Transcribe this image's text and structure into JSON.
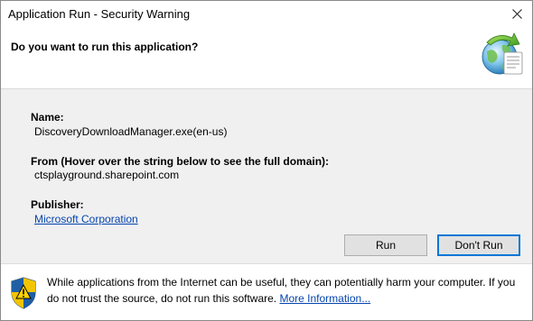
{
  "window": {
    "title": "Application Run - Security Warning",
    "close_glyph": "✕"
  },
  "header": {
    "question": "Do you want to run this application?",
    "icon": "application-globe-icon"
  },
  "details": {
    "name_label": "Name:",
    "name_value": "DiscoveryDownloadManager.exe(en-us)",
    "from_label": "From (Hover over the string below to see the full domain):",
    "from_value": "ctsplayground.sharepoint.com",
    "publisher_label": "Publisher:",
    "publisher_value": "Microsoft Corporation"
  },
  "buttons": {
    "run": "Run",
    "dont_run": "Don't Run"
  },
  "footer": {
    "icon": "security-shield-icon",
    "warning_text": "While applications from the Internet can be useful, they can potentially harm your computer. If you do not trust the source, do not run this software.",
    "more_info_link": "More Information..."
  },
  "colors": {
    "link": "#0645ad",
    "default_button_border": "#0078d7",
    "body_background": "#f0f0f0"
  }
}
